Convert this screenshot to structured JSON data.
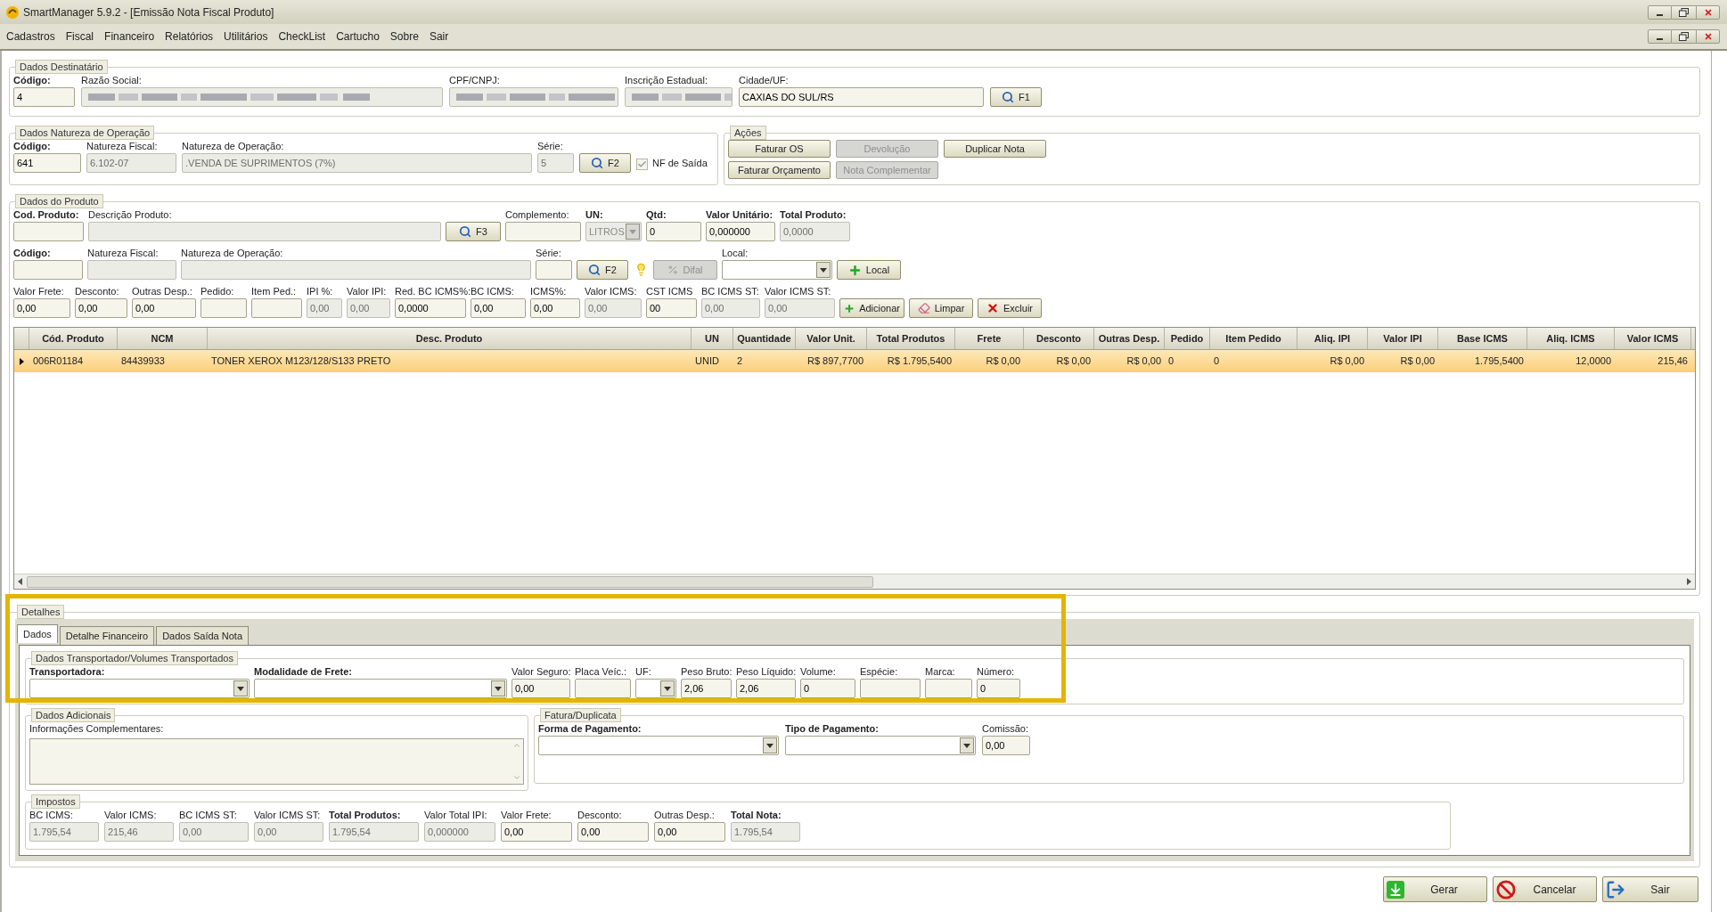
{
  "window": {
    "title": "SmartManager 5.9.2 - [Emissão Nota Fiscal Produto]"
  },
  "menu": [
    "Cadastros",
    "Fiscal",
    "Financeiro",
    "Relatórios",
    "Utilitários",
    "CheckList",
    "Cartucho",
    "Sobre",
    "Sair"
  ],
  "destinatario": {
    "legend": "Dados Destinatário",
    "items": [
      {
        "kind": "field",
        "label": "Código:",
        "bold": true,
        "value": "4",
        "disabled": false
      },
      {
        "kind": "field",
        "label": "Razão Social:",
        "redacted": true,
        "disabled": true
      },
      {
        "kind": "field",
        "label": "CPF/CNPJ:",
        "redacted": true,
        "disabled": true
      },
      {
        "kind": "field",
        "label": "Inscrição Estadual:",
        "redacted": true,
        "disabled": true
      },
      {
        "kind": "field",
        "label": "Cidade/UF:",
        "value": "CAXIAS DO SUL/RS",
        "disabled": false
      },
      {
        "kind": "button",
        "label": "F1",
        "disabled": false
      }
    ]
  },
  "natureza": {
    "legend": "Dados Natureza de Operação",
    "items": [
      {
        "kind": "field",
        "label": "Código:",
        "bold": true,
        "value": "641",
        "disabled": false
      },
      {
        "kind": "field",
        "label": "Natureza Fiscal:",
        "value": "6.102-07",
        "disabled": true
      },
      {
        "kind": "field",
        "label": "Natureza de Operação:",
        "value": ".VENDA DE SUPRIMENTOS (7%)",
        "disabled": true
      },
      {
        "kind": "field",
        "label": "Série:",
        "value": "5",
        "disabled": true
      },
      {
        "kind": "button",
        "label": "F2",
        "disabled": false
      },
      {
        "kind": "check",
        "label": "NF de Saída",
        "checked": true
      }
    ]
  },
  "acoes": {
    "legend": "Ações",
    "buttons": [
      {
        "label": "Faturar OS",
        "disabled": false
      },
      {
        "label": "Devolução",
        "disabled": true
      },
      {
        "label": "Duplicar Nota",
        "disabled": false
      },
      {
        "label": "Faturar Orçamento",
        "disabled": false
      },
      {
        "label": "Nota Complementar",
        "disabled": true
      }
    ]
  },
  "produto": {
    "legend": "Dados do Produto",
    "form": [
      {
        "items": [
          {
            "kind": "field",
            "label": "Cod. Produto:",
            "bold": true,
            "disabled": false
          },
          {
            "kind": "field",
            "label": "Descrição Produto:",
            "disabled": true
          },
          {
            "kind": "button",
            "label": "F3",
            "disabled": false
          },
          {
            "kind": "field",
            "label": "Complemento:",
            "disabled": false
          },
          {
            "kind": "combo",
            "label": "UN:",
            "bold": true,
            "value": "LITROS",
            "disabled": true
          },
          {
            "kind": "field",
            "label": "Qtd:",
            "bold": true,
            "value": "0",
            "disabled": false
          },
          {
            "kind": "field",
            "label": "Valor Unitário:",
            "bold": true,
            "value": "0,000000",
            "disabled": false
          },
          {
            "kind": "field",
            "label": "Total Produto:",
            "bold": true,
            "value": "0,0000",
            "disabled": true
          }
        ]
      },
      {
        "items": [
          {
            "kind": "field",
            "label": "Código:",
            "bold": true,
            "disabled": false
          },
          {
            "kind": "field",
            "label": "Natureza Fiscal:",
            "disabled": true
          },
          {
            "kind": "field",
            "label": "Natureza de Operação:",
            "disabled": true
          },
          {
            "kind": "field",
            "label": "Série:",
            "disabled": false
          },
          {
            "kind": "button",
            "label": "F2",
            "disabled": false
          },
          {
            "kind": "lamp"
          },
          {
            "kind": "button",
            "label": "Difal",
            "disabled": true
          },
          {
            "kind": "combo",
            "label": "Local:",
            "disabled": false
          },
          {
            "kind": "button",
            "label": "Local",
            "disabled": false
          }
        ]
      },
      {
        "items": [
          {
            "kind": "field",
            "label": "Valor Frete:",
            "value": "0,00",
            "disabled": false
          },
          {
            "kind": "field",
            "label": "Desconto:",
            "value": "0,00",
            "disabled": false
          },
          {
            "kind": "field",
            "label": "Outras Desp.:",
            "value": "0,00",
            "disabled": false
          },
          {
            "kind": "field",
            "label": "Pedido:",
            "disabled": false
          },
          {
            "kind": "field",
            "label": "Item Ped.:",
            "disabled": false
          },
          {
            "kind": "field",
            "label": "IPI %:",
            "value": "0,00",
            "disabled": true
          },
          {
            "kind": "field",
            "label": "Valor IPI:",
            "value": "0,00",
            "disabled": true
          },
          {
            "kind": "field",
            "label": "Red. BC ICMS%:",
            "value": "0,0000",
            "disabled": false
          },
          {
            "kind": "field",
            "label": "BC ICMS:",
            "value": "0,00",
            "disabled": false
          },
          {
            "kind": "field",
            "label": "ICMS%:",
            "value": "0,00",
            "disabled": false
          },
          {
            "kind": "field",
            "label": "Valor ICMS:",
            "value": "0,00",
            "disabled": true
          },
          {
            "kind": "field",
            "label": "CST ICMS",
            "value": "00",
            "disabled": false
          },
          {
            "kind": "field",
            "label": "BC ICMS ST:",
            "value": "0,00",
            "disabled": true
          },
          {
            "kind": "field",
            "label": "Valor ICMS ST:",
            "value": "0,00",
            "disabled": true
          },
          {
            "kind": "button",
            "label": "Adicionar",
            "disabled": false
          },
          {
            "kind": "button",
            "label": "Limpar",
            "disabled": false
          },
          {
            "kind": "button",
            "label": "Excluir",
            "disabled": false
          }
        ]
      }
    ],
    "table": {
      "columns": [
        "Cód. Produto",
        "NCM",
        "Desc. Produto",
        "UN",
        "Quantidade",
        "Valor Unit.",
        "Total Produtos",
        "Frete",
        "Desconto",
        "Outras Desp.",
        "Pedido",
        "Item Pedido",
        "Aliq. IPI",
        "Valor IPI",
        "Base ICMS",
        "Aliq. ICMS",
        "Valor ICMS"
      ],
      "rows": [
        {
          "selected": true,
          "cells": [
            "006R01184",
            "84439933",
            "TONER XEROX M123/128/S133 PRETO",
            "UNID",
            "2",
            "R$ 897,7700",
            "R$ 1.795,5400",
            "R$ 0,00",
            "R$ 0,00",
            "R$ 0,00",
            "0",
            "0",
            "R$ 0,00",
            "R$ 0,00",
            "1.795,5400",
            "12,0000",
            "215,46"
          ]
        }
      ]
    }
  },
  "detalhes": {
    "legend": "Detalhes",
    "tabs": [
      {
        "label": "Dados",
        "selected": true
      },
      {
        "label": "Detalhe Financeiro",
        "selected": false
      },
      {
        "label": "Dados Saída Nota",
        "selected": false
      }
    ],
    "transporte": {
      "legend": "Dados Transportador/Volumes Transportados",
      "items": [
        {
          "kind": "combo",
          "label": "Transportadora:",
          "bold": true,
          "disabled": false
        },
        {
          "kind": "combo",
          "label": "Modalidade de Frete:",
          "bold": true,
          "disabled": false
        },
        {
          "kind": "field",
          "label": "Valor Seguro:",
          "value": "0,00",
          "disabled": false
        },
        {
          "kind": "field",
          "label": "Placa Veíc.:",
          "disabled": false
        },
        {
          "kind": "combo",
          "label": "UF:",
          "disabled": false
        },
        {
          "kind": "field",
          "label": "Peso Bruto:",
          "value": "2,06",
          "disabled": false
        },
        {
          "kind": "field",
          "label": "Peso Líquido:",
          "value": "2,06",
          "disabled": false
        },
        {
          "kind": "field",
          "label": "Volume:",
          "value": "0",
          "disabled": false
        },
        {
          "kind": "field",
          "label": "Espécie:",
          "disabled": false
        },
        {
          "kind": "field",
          "label": "Marca:",
          "disabled": false
        },
        {
          "kind": "field",
          "label": "Número:",
          "value": "0",
          "disabled": false
        }
      ]
    },
    "adicionais": {
      "legend": "Dados Adicionais",
      "label": "Informações Complementares:"
    },
    "fatura": {
      "legend": "Fatura/Duplicata",
      "items": [
        {
          "kind": "combo",
          "label": "Forma de Pagamento:",
          "bold": true,
          "disabled": false
        },
        {
          "kind": "combo",
          "label": "Tipo de Pagamento:",
          "bold": true,
          "disabled": false
        },
        {
          "kind": "field",
          "label": "Comissão:",
          "value": "0,00",
          "disabled": false
        }
      ]
    },
    "impostos": {
      "legend": "Impostos",
      "items": [
        {
          "kind": "field",
          "label": "BC ICMS:",
          "value": "1.795,54",
          "disabled": true
        },
        {
          "kind": "field",
          "label": "Valor ICMS:",
          "value": "215,46",
          "disabled": true
        },
        {
          "kind": "field",
          "label": "BC ICMS ST:",
          "value": "0,00",
          "disabled": true
        },
        {
          "kind": "field",
          "label": "Valor ICMS ST:",
          "value": "0,00",
          "disabled": true
        },
        {
          "kind": "field",
          "label": "Total Produtos:",
          "bold": true,
          "value": "1.795,54",
          "disabled": true
        },
        {
          "kind": "field",
          "label": "Valor Total IPI:",
          "value": "0,000000",
          "disabled": true
        },
        {
          "kind": "field",
          "label": "Valor Frete:",
          "value": "0,00",
          "disabled": false
        },
        {
          "kind": "field",
          "label": "Desconto:",
          "value": "0,00",
          "disabled": false
        },
        {
          "kind": "field",
          "label": "Outras Desp.:",
          "value": "0,00",
          "disabled": false
        },
        {
          "kind": "field",
          "label": "Total Nota:",
          "bold": true,
          "value": "1.795,54",
          "disabled": true
        }
      ]
    }
  },
  "footer_buttons": [
    {
      "label": "Gerar"
    },
    {
      "label": "Cancelar"
    },
    {
      "label": "Sair"
    }
  ]
}
